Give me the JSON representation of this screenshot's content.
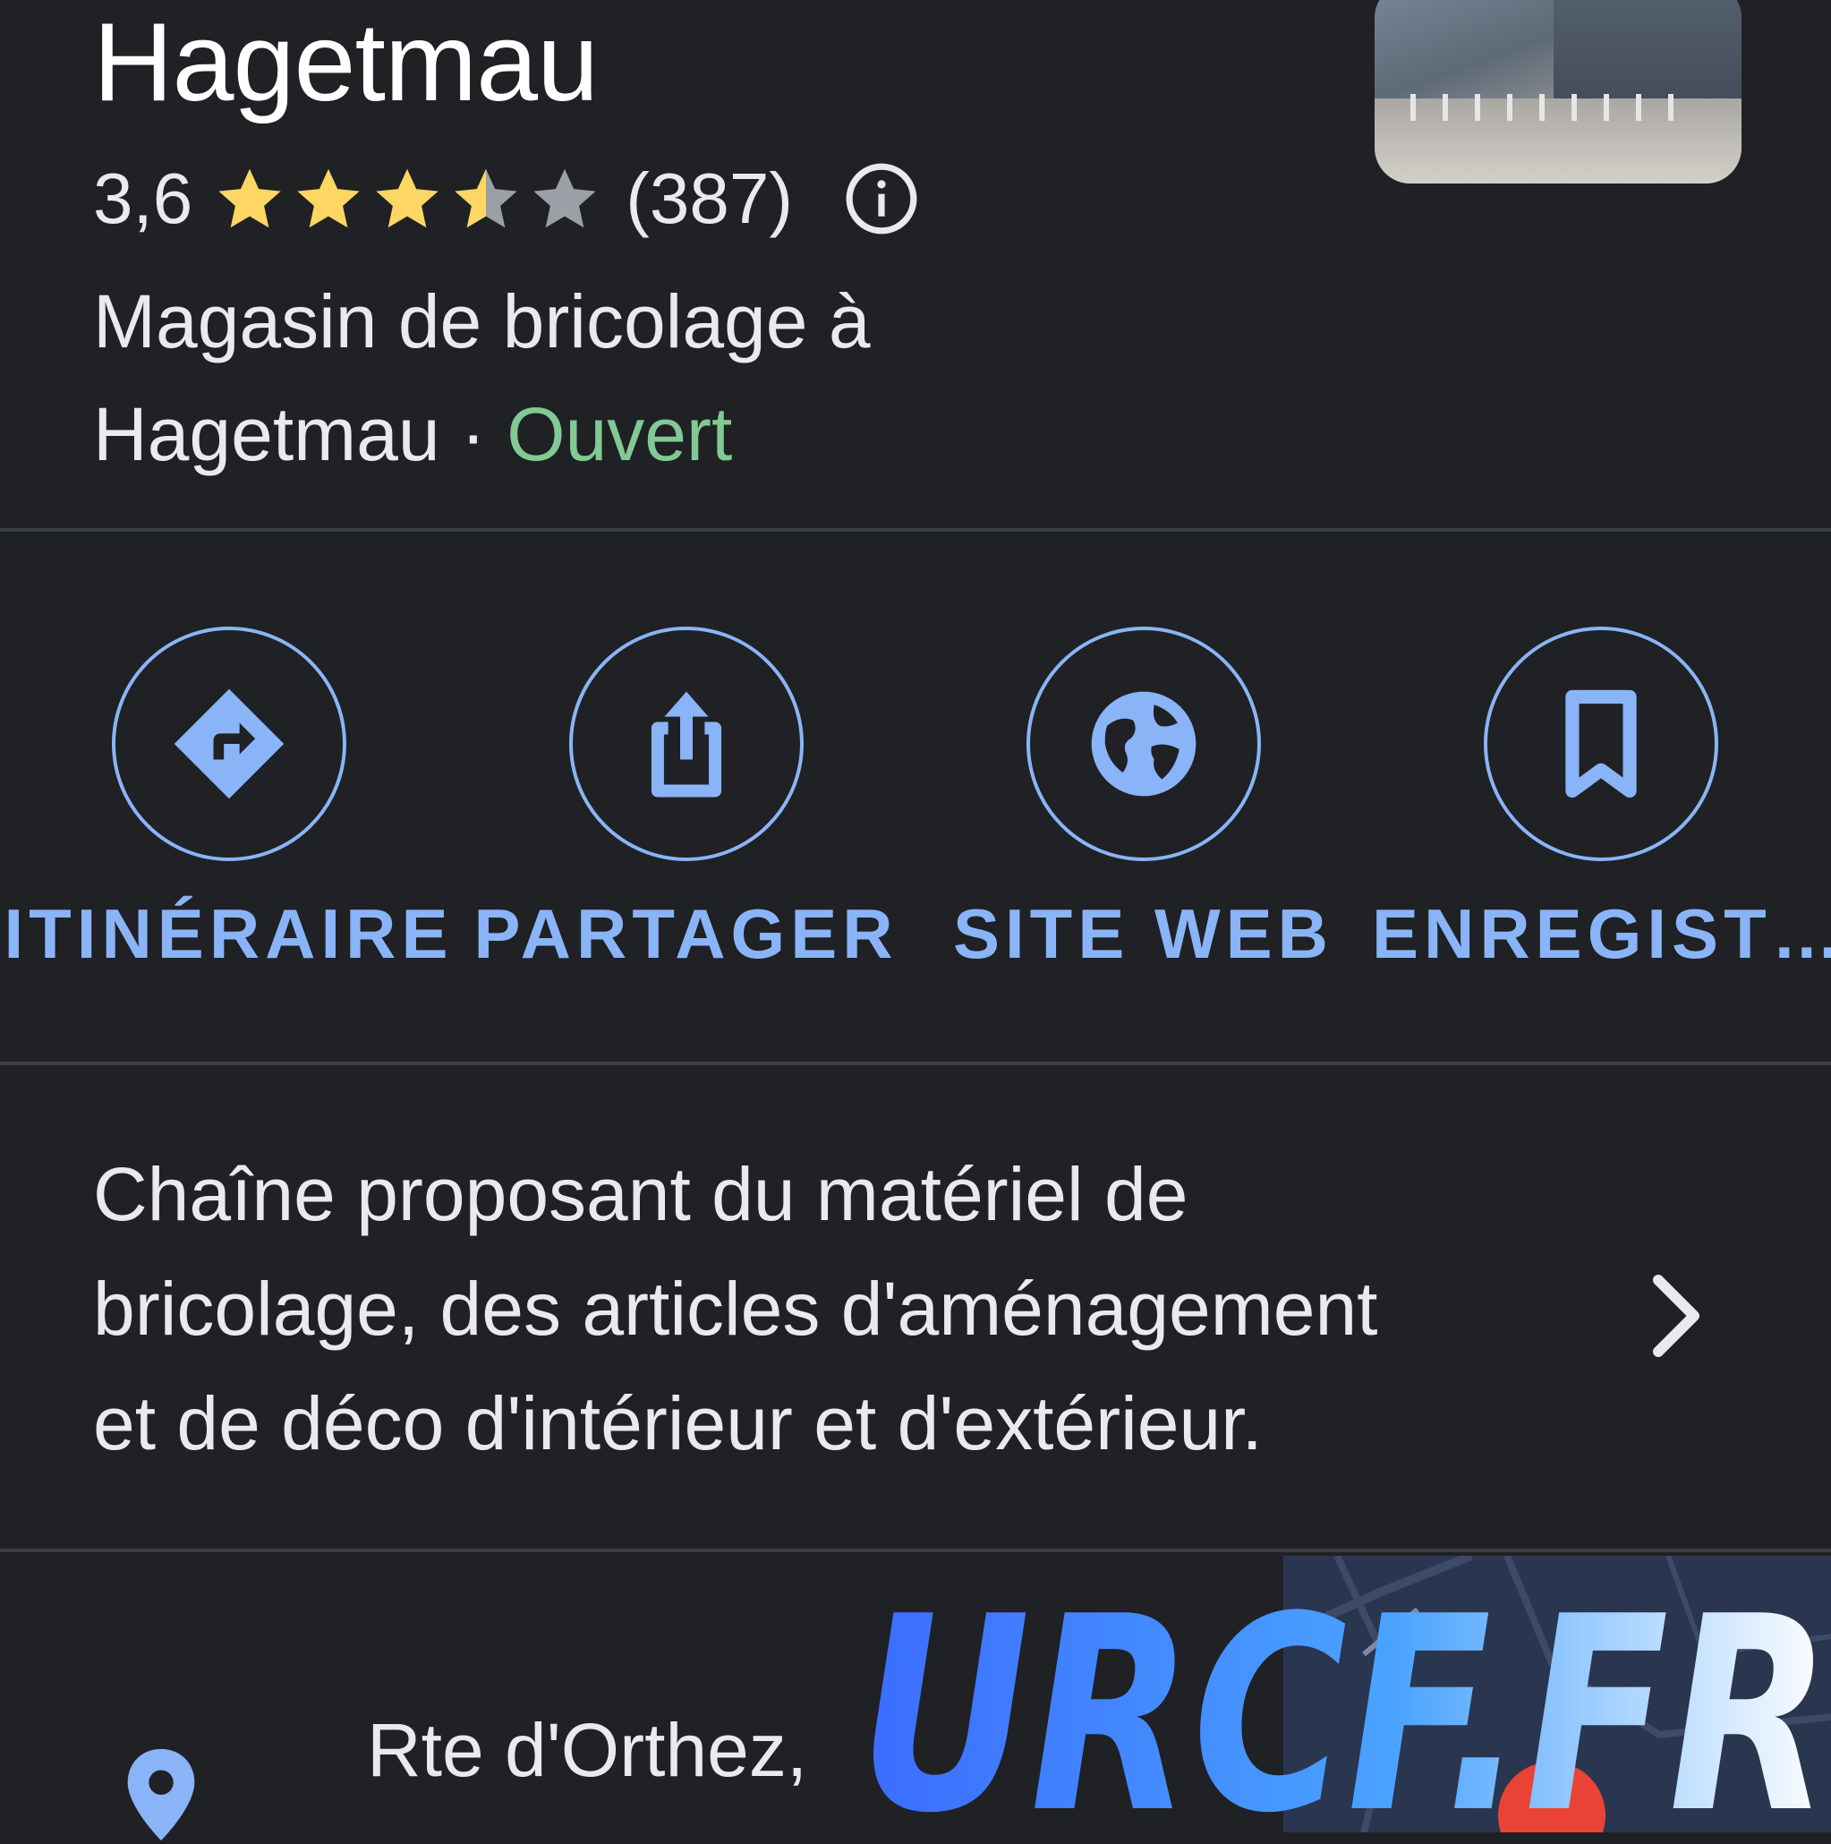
{
  "place": {
    "name": "Hagetmau",
    "rating": "3,6",
    "rating_value": 3.6,
    "rating_max": 5,
    "review_count": "(387)",
    "category_line1": "Magasin de bricolage à",
    "category_line2": "Hagetmau",
    "separator": "·",
    "status": "Ouvert"
  },
  "actions": [
    {
      "label": "ITINÉRAIRE",
      "icon": "directions-icon"
    },
    {
      "label": "PARTAGER",
      "icon": "share-icon"
    },
    {
      "label": "SITE WEB",
      "icon": "globe-icon"
    },
    {
      "label": "ENREGIST…",
      "icon": "bookmark-icon"
    }
  ],
  "description": {
    "line1": "Chaîne proposant du matériel de",
    "line2": "bricolage, des articles d'aménagement",
    "line3": "et de déco d'intérieur et d'extérieur."
  },
  "address": {
    "text": "Rte d'Orthez, "
  },
  "watermark": {
    "text": "URCF.FR"
  },
  "colors": {
    "background": "#202124",
    "accent": "#8ab4f8",
    "open_green": "#81c995",
    "star_yellow": "#fdd663",
    "star_grey": "#9aa0a6"
  }
}
